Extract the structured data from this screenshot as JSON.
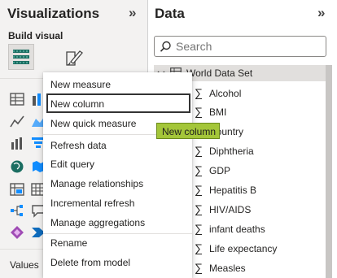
{
  "visualizations": {
    "title": "Visualizations",
    "collapse_glyph": "»",
    "build_visual_label": "Build visual",
    "values_label": "Values",
    "icons": [
      "table-icon",
      "stacked-bar-chart-icon",
      "line-chart-icon",
      "area-chart-icon",
      "column-chart-icon",
      "funnel-chart-icon",
      "map-icon",
      "filled-map-icon",
      "matrix-icon",
      "table-grid-icon",
      "decomposition-tree-icon",
      "smart-narrative-icon",
      "power-apps-icon",
      "power-automate-icon"
    ]
  },
  "data_pane": {
    "title": "Data",
    "collapse_glyph": "»",
    "search_placeholder": "Search",
    "dataset": {
      "name": "World Data Set",
      "fields": [
        "Alcohol",
        "BMI",
        "Country",
        "Diphtheria",
        "GDP",
        "Hepatitis B",
        "HIV/AIDS",
        "infant deaths",
        "Life expectancy",
        "Measles"
      ]
    }
  },
  "context_menu": {
    "items": [
      "New measure",
      "New column",
      "New quick measure",
      "Refresh data",
      "Edit query",
      "Manage relationships",
      "Incremental refresh",
      "Manage aggregations",
      "Rename",
      "Delete from model"
    ],
    "selected_index": 1
  },
  "tooltip": {
    "text": "New column"
  },
  "colors": {
    "pane_background": "#f3f2f1",
    "icon_teal": "#118dff",
    "tooltip_background": "#a4c639",
    "dataset_row": "#e1dfdd"
  }
}
